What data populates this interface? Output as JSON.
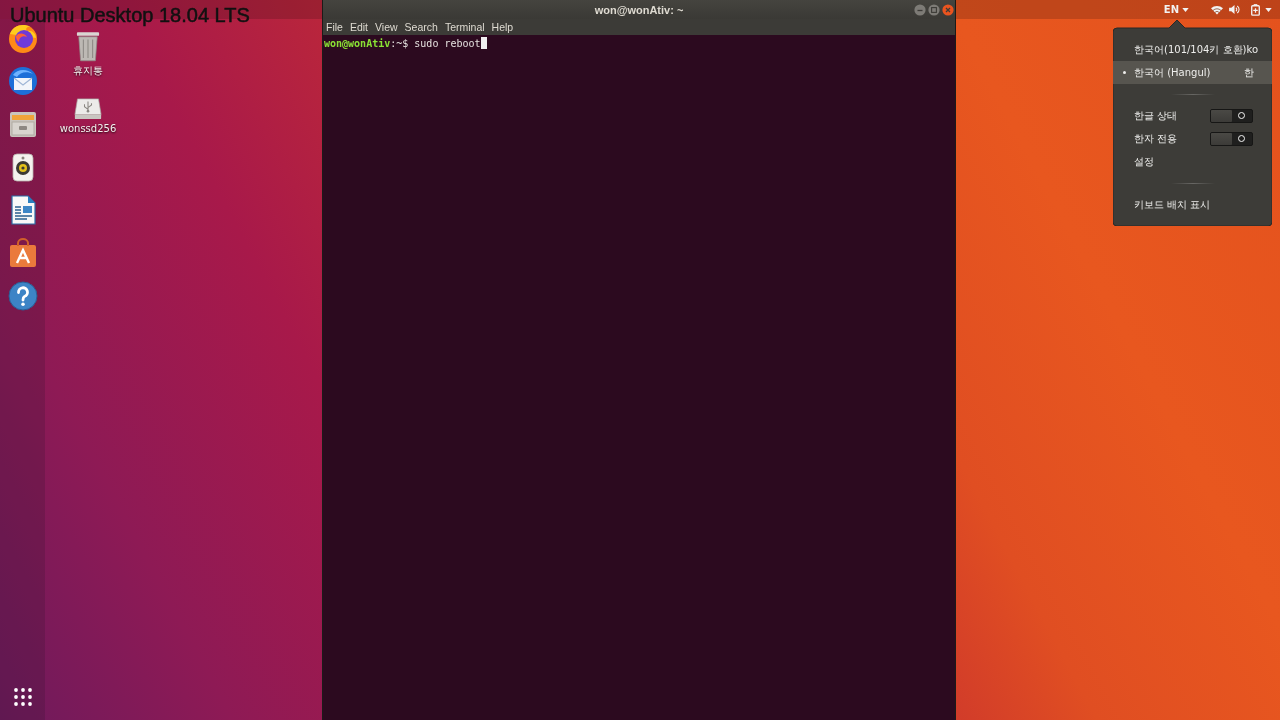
{
  "caption": "Ubuntu Desktop 18.04 LTS",
  "top_bar": {
    "input_source": "EN"
  },
  "desktop_icons": [
    {
      "kind": "trash",
      "label": "휴지통"
    },
    {
      "kind": "drive",
      "label": "wonssd256"
    }
  ],
  "terminal": {
    "title": "won@wonAtiv: ~",
    "menu": [
      "File",
      "Edit",
      "View",
      "Search",
      "Terminal",
      "Help"
    ],
    "lines": [
      {
        "prompt": "won@wonAtiv",
        "text": ":~$ sudo reboot",
        "cursor": true
      }
    ]
  },
  "input_menu": {
    "items": [
      {
        "kind": "source",
        "label": "한국어(101/104키 호환)",
        "code": "ko",
        "selected": false
      },
      {
        "kind": "source",
        "label": "한국어 (Hangul)",
        "code": "한",
        "selected": true
      },
      {
        "kind": "separator"
      },
      {
        "kind": "toggle",
        "label": "한글 상태",
        "on": false
      },
      {
        "kind": "toggle",
        "label": "한자 전용",
        "on": false
      },
      {
        "kind": "action",
        "label": "설정"
      },
      {
        "kind": "separator"
      },
      {
        "kind": "action",
        "label": "키보드 배치 표시"
      }
    ]
  }
}
